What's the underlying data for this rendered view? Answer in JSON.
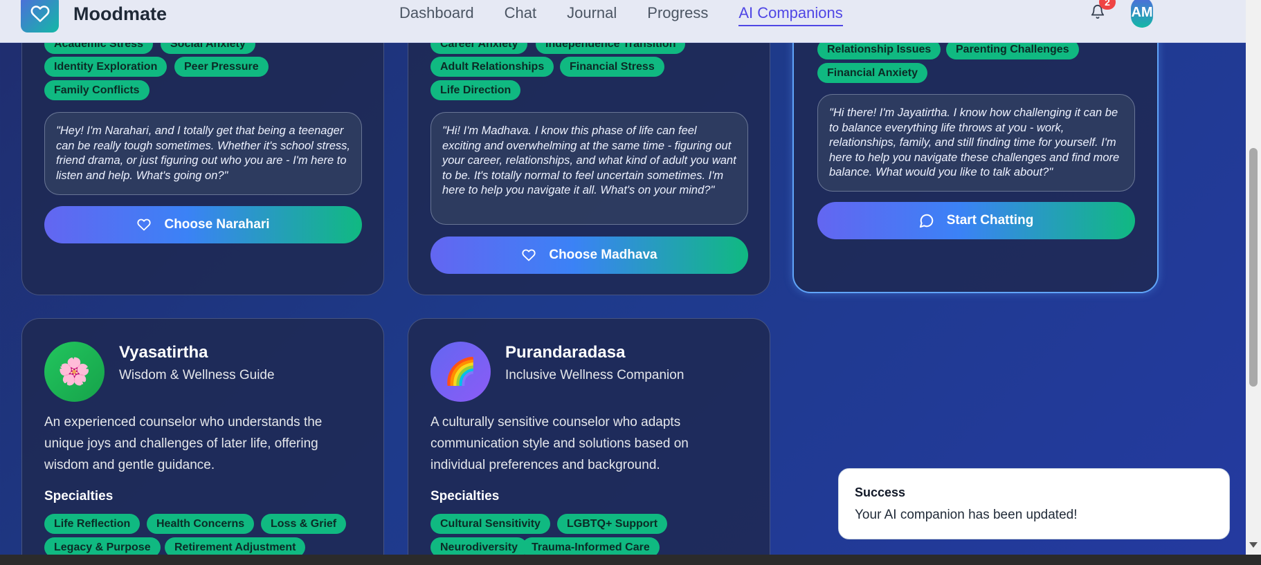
{
  "header": {
    "brand": "Moodmate",
    "nav": [
      "Dashboard",
      "Chat",
      "Journal",
      "Progress",
      "AI Companions"
    ],
    "active_nav": "AI Companions",
    "notification_count": "2",
    "avatar_initials": "AM"
  },
  "companions_top": [
    {
      "tags_cut": [
        "Academic Stress",
        "Social Anxiety"
      ],
      "tags": [
        "Identity Exploration",
        "Peer Pressure",
        "Family Conflicts"
      ],
      "quote": "\"Hey! I'm Narahari, and I totally get that being a teenager can be really tough sometimes. Whether it's school stress, friend drama, or just figuring out who you are - I'm here to listen and help. What's going on?\"",
      "button": "Choose Narahari"
    },
    {
      "tags_cut": [
        "Career Anxiety",
        "Independence Transition"
      ],
      "tags": [
        "Adult Relationships",
        "Financial Stress",
        "Life Direction"
      ],
      "quote": "\"Hi! I'm Madhava. I know this phase of life can feel exciting and overwhelming at the same time - figuring out your career, relationships, and what kind of adult you want to be. It's totally normal to feel uncertain sometimes. I'm here to help you navigate it all. What's on your mind?\"",
      "button": "Choose Madhava"
    },
    {
      "tags": [
        "Relationship Issues",
        "Parenting Challenges",
        "Financial Anxiety"
      ],
      "quote": "\"Hi there! I'm Jayatirtha. I know how challenging it can be to balance everything life throws at you - work, relationships, family, and still finding time for yourself. I'm here to help you navigate these challenges and find more balance. What would you like to talk about?\"",
      "button": "Start Chatting"
    }
  ],
  "companions_bottom": [
    {
      "name": "Vyasatirtha",
      "role": "Wisdom & Wellness Guide",
      "emoji": "🌸",
      "description": "An experienced counselor who understands the unique joys and challenges of later life, offering wisdom and gentle guidance.",
      "specialties_label": "Specialties",
      "tags": [
        "Life Reflection",
        "Health Concerns",
        "Loss & Grief",
        "Legacy & Purpose",
        "Retirement Adjustment"
      ]
    },
    {
      "name": "Purandaradasa",
      "role": "Inclusive Wellness Companion",
      "emoji": "🌈",
      "description": "A culturally sensitive counselor who adapts communication style and solutions based on individual preferences and background.",
      "specialties_label": "Specialties",
      "tags": [
        "Cultural Sensitivity",
        "LGBTQ+ Support",
        "Neurodiversity",
        "Trauma-Informed Care"
      ]
    }
  ],
  "toast": {
    "title": "Success",
    "message": "Your AI companion has been updated!"
  },
  "colors": {
    "accent": "#4f46e5",
    "tag": "#10b981",
    "selected_border": "#60a5fa"
  }
}
